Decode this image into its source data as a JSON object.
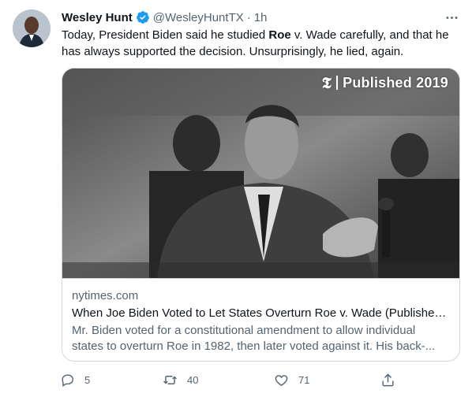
{
  "tweet": {
    "author_name": "Wesley Hunt",
    "handle": "@WesleyHuntTX",
    "separator": "·",
    "time": "1h",
    "text": {
      "part1": "Today, President Biden said he studied ",
      "bold": "Roe",
      "part2": " v. Wade carefully, and that he has always supported the decision. Unsurprisingly, he lied, again."
    }
  },
  "card": {
    "badge_logo": "𝕿",
    "badge_label": "Published 2019",
    "domain": "nytimes.com",
    "title": "When Joe Biden Voted to Let States Overturn Roe v. Wade (Published ...",
    "description": "Mr. Biden voted for a constitutional amendment to allow individual states to overturn Roe in 1982, then later voted against it. His back-..."
  },
  "actions": {
    "reply_count": "5",
    "retweet_count": "40",
    "like_count": "71"
  },
  "colors": {
    "text_primary": "#0f1419",
    "text_secondary": "#536471",
    "verified": "#1d9bf0",
    "border": "#cfd9de"
  },
  "icons": [
    "more-icon",
    "verified-icon",
    "reply-icon",
    "retweet-icon",
    "like-icon",
    "share-icon",
    "nyt-logo-icon"
  ]
}
